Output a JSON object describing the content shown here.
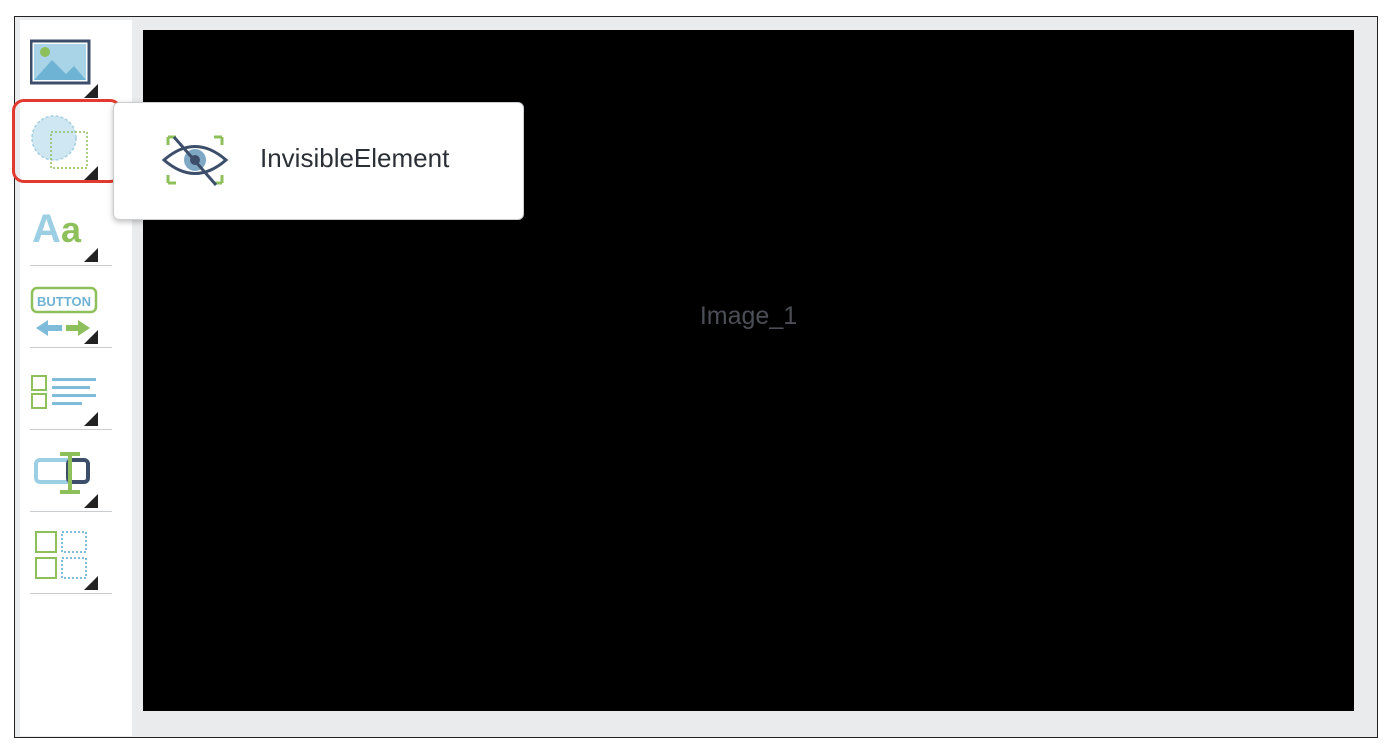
{
  "toolbar": {
    "tools": [
      {
        "name": "image-tool",
        "icon": "image-icon"
      },
      {
        "name": "invisible-element-tool",
        "icon": "invisible-shape-icon",
        "highlighted": true
      },
      {
        "name": "text-tool",
        "icon": "text-icon",
        "glyph": "Aa"
      },
      {
        "name": "button-tool",
        "icon": "button-icon",
        "glyph": "BUTTON"
      },
      {
        "name": "list-tool",
        "icon": "list-icon"
      },
      {
        "name": "input-tool",
        "icon": "text-input-icon"
      },
      {
        "name": "grid-tool",
        "icon": "grid-icon"
      }
    ]
  },
  "popup": {
    "item_label": "InvisibleElement",
    "item_icon": "eye-slash-icon"
  },
  "canvas": {
    "label": "Image_1"
  },
  "colors": {
    "highlight": "#e23a2e",
    "accent_blue": "#8fc6de",
    "accent_green": "#8dbf5a",
    "icon_dark": "#4b5e7a"
  }
}
